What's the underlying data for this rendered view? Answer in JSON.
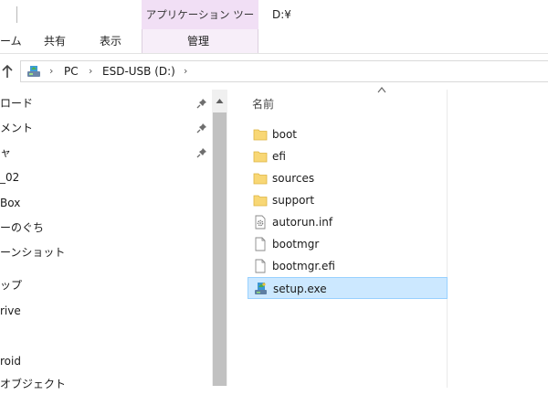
{
  "ribbon": {
    "contextual_header": "アプリケーション ツール",
    "window_title": "D:¥",
    "tabs": [
      {
        "label": "ーム"
      },
      {
        "label": "共有"
      },
      {
        "label": "表示"
      },
      {
        "label": "管理"
      }
    ]
  },
  "address_bar": {
    "crumbs": [
      "PC",
      "ESD-USB (D:)"
    ]
  },
  "nav_pane": {
    "items": [
      {
        "label": "ロード",
        "pinned": true
      },
      {
        "label": "メント",
        "pinned": true
      },
      {
        "label": "ャ",
        "pinned": true
      },
      {
        "label": "_02"
      },
      {
        "label": "Box"
      },
      {
        "label": "ーのぐち"
      },
      {
        "label": "ーンショット"
      },
      {
        "label": "ップ"
      },
      {
        "label": "rive"
      },
      {
        "label": ""
      },
      {
        "label": "roid"
      },
      {
        "label": "オブジェクト"
      }
    ]
  },
  "file_list": {
    "column_name": "名前",
    "items": [
      {
        "name": "boot",
        "icon": "folder-icon",
        "selected": false
      },
      {
        "name": "efi",
        "icon": "folder-icon",
        "selected": false
      },
      {
        "name": "sources",
        "icon": "folder-icon",
        "selected": false
      },
      {
        "name": "support",
        "icon": "folder-icon",
        "selected": false
      },
      {
        "name": "autorun.inf",
        "icon": "settings-file-icon",
        "selected": false
      },
      {
        "name": "bootmgr",
        "icon": "file-icon",
        "selected": false
      },
      {
        "name": "bootmgr.efi",
        "icon": "file-icon",
        "selected": false
      },
      {
        "name": "setup.exe",
        "icon": "setup-exe-icon",
        "selected": true
      }
    ]
  },
  "colors": {
    "contextual_tab": "#f1dff5",
    "selection_fill": "#cce8ff",
    "selection_border": "#99d1ff",
    "folder": "#f8d775"
  }
}
